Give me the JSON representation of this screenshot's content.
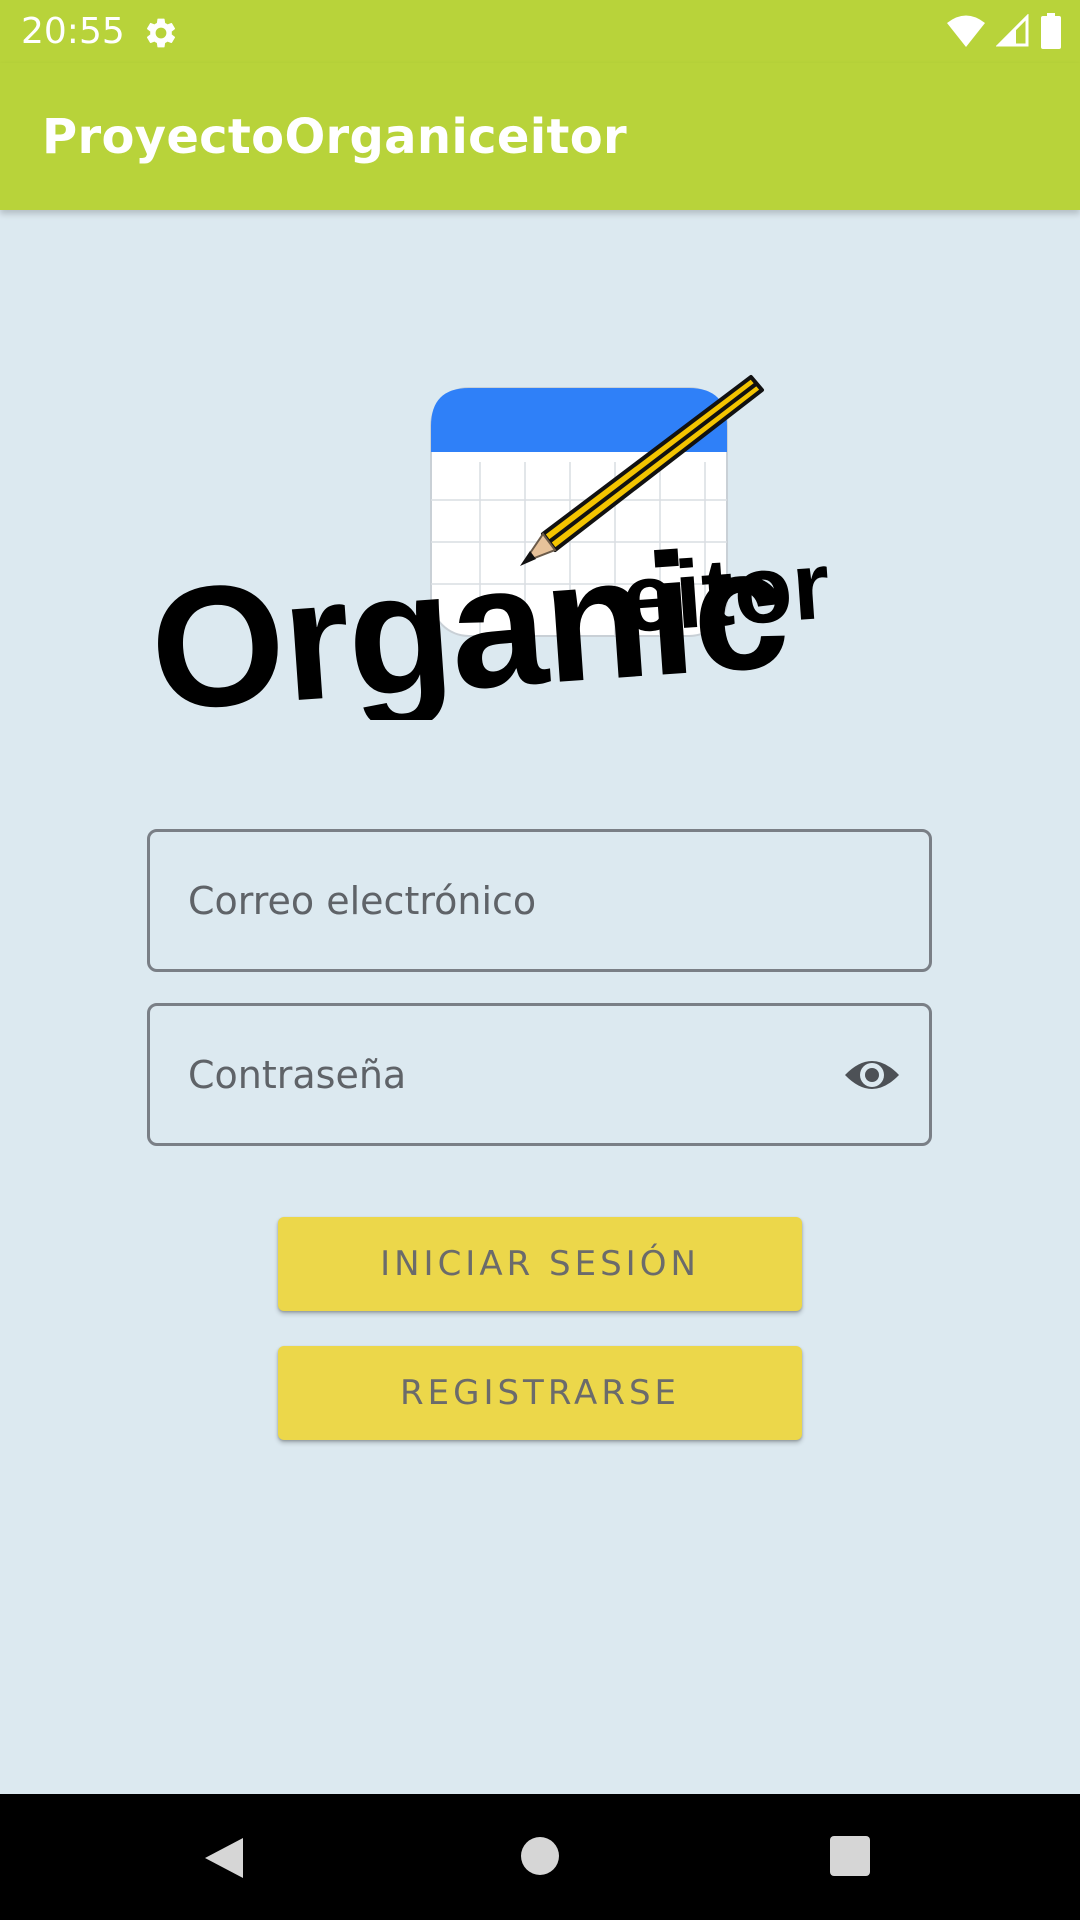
{
  "status_bar": {
    "time": "20:55",
    "icons": [
      "gear-icon",
      "wifi-icon",
      "signal-icon",
      "battery-icon"
    ]
  },
  "app_bar": {
    "title": "ProyectoOrganiceitor"
  },
  "logo": {
    "text_large": "Organic",
    "text_small": "eitor"
  },
  "form": {
    "email": {
      "placeholder": "Correo electrónico",
      "value": ""
    },
    "password": {
      "placeholder": "Contraseña",
      "value": "",
      "toggle_icon": "eye-icon"
    }
  },
  "buttons": {
    "login_label": "INICIAR SESIÓN",
    "register_label": "REGISTRARSE"
  },
  "nav_bar": {
    "icons": [
      "back-icon",
      "home-icon",
      "recents-icon"
    ]
  },
  "colors": {
    "app_bar": "#b8d33a",
    "background": "#dce9f0",
    "button": "#ecd74a",
    "button_text": "#6b6b6b",
    "field_border": "#7a7f86",
    "calendar_header": "#2f80f8",
    "pencil": "#f3c400"
  }
}
